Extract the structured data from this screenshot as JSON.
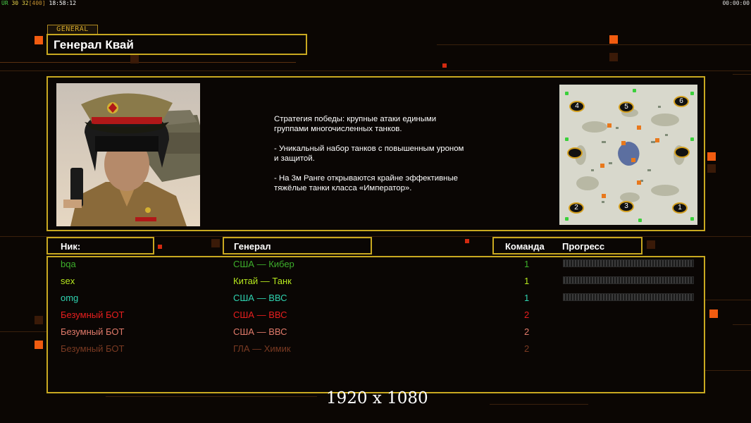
{
  "hud": {
    "fps_label": "ÜR",
    "fps": "30",
    "ms": "32",
    "ms_max": "[400]",
    "clock": "18:58:12",
    "timer": "00:00:00"
  },
  "general_tag": "GENERAL",
  "general_name": "Генерал Квай",
  "description": [
    "Стратегия победы: крупные атаки едиными\n группами многочисленных танков.",
    "- Уникальный набор танков с повышенным уроном\n и защитой.",
    "- На 3м Ранге открываются крайне эффективные\n тяжёлые танки класса «Император»."
  ],
  "map": {
    "start_positions": [
      "4",
      "5",
      "6",
      "2",
      "3",
      "1"
    ]
  },
  "headers": {
    "nick": "Ник:",
    "general": "Генерал",
    "team": "Команда",
    "progress": "Прогресс"
  },
  "players": [
    {
      "nick": "bqa",
      "general": "США — Кибер",
      "team": "1",
      "color": "#3dae2b",
      "progress": 0
    },
    {
      "nick": "sex",
      "general": "Китай — Танк",
      "team": "1",
      "color": "#b6e81e",
      "progress": 0
    },
    {
      "nick": "omg",
      "general": "США — ВВС",
      "team": "1",
      "color": "#2fd3b0",
      "progress": 0
    },
    {
      "nick": "Безумный БОТ",
      "general": "США — ВВС",
      "team": "2",
      "color": "#e81e1e"
    },
    {
      "nick": "Безумный БОТ",
      "general": "США — ВВС",
      "team": "2",
      "color": "#e07a6a"
    },
    {
      "nick": "Безумный БОТ",
      "general": "ГЛА — Химик",
      "team": "2",
      "color": "#7a3a22"
    }
  ],
  "resolution": "1920 x 1080"
}
